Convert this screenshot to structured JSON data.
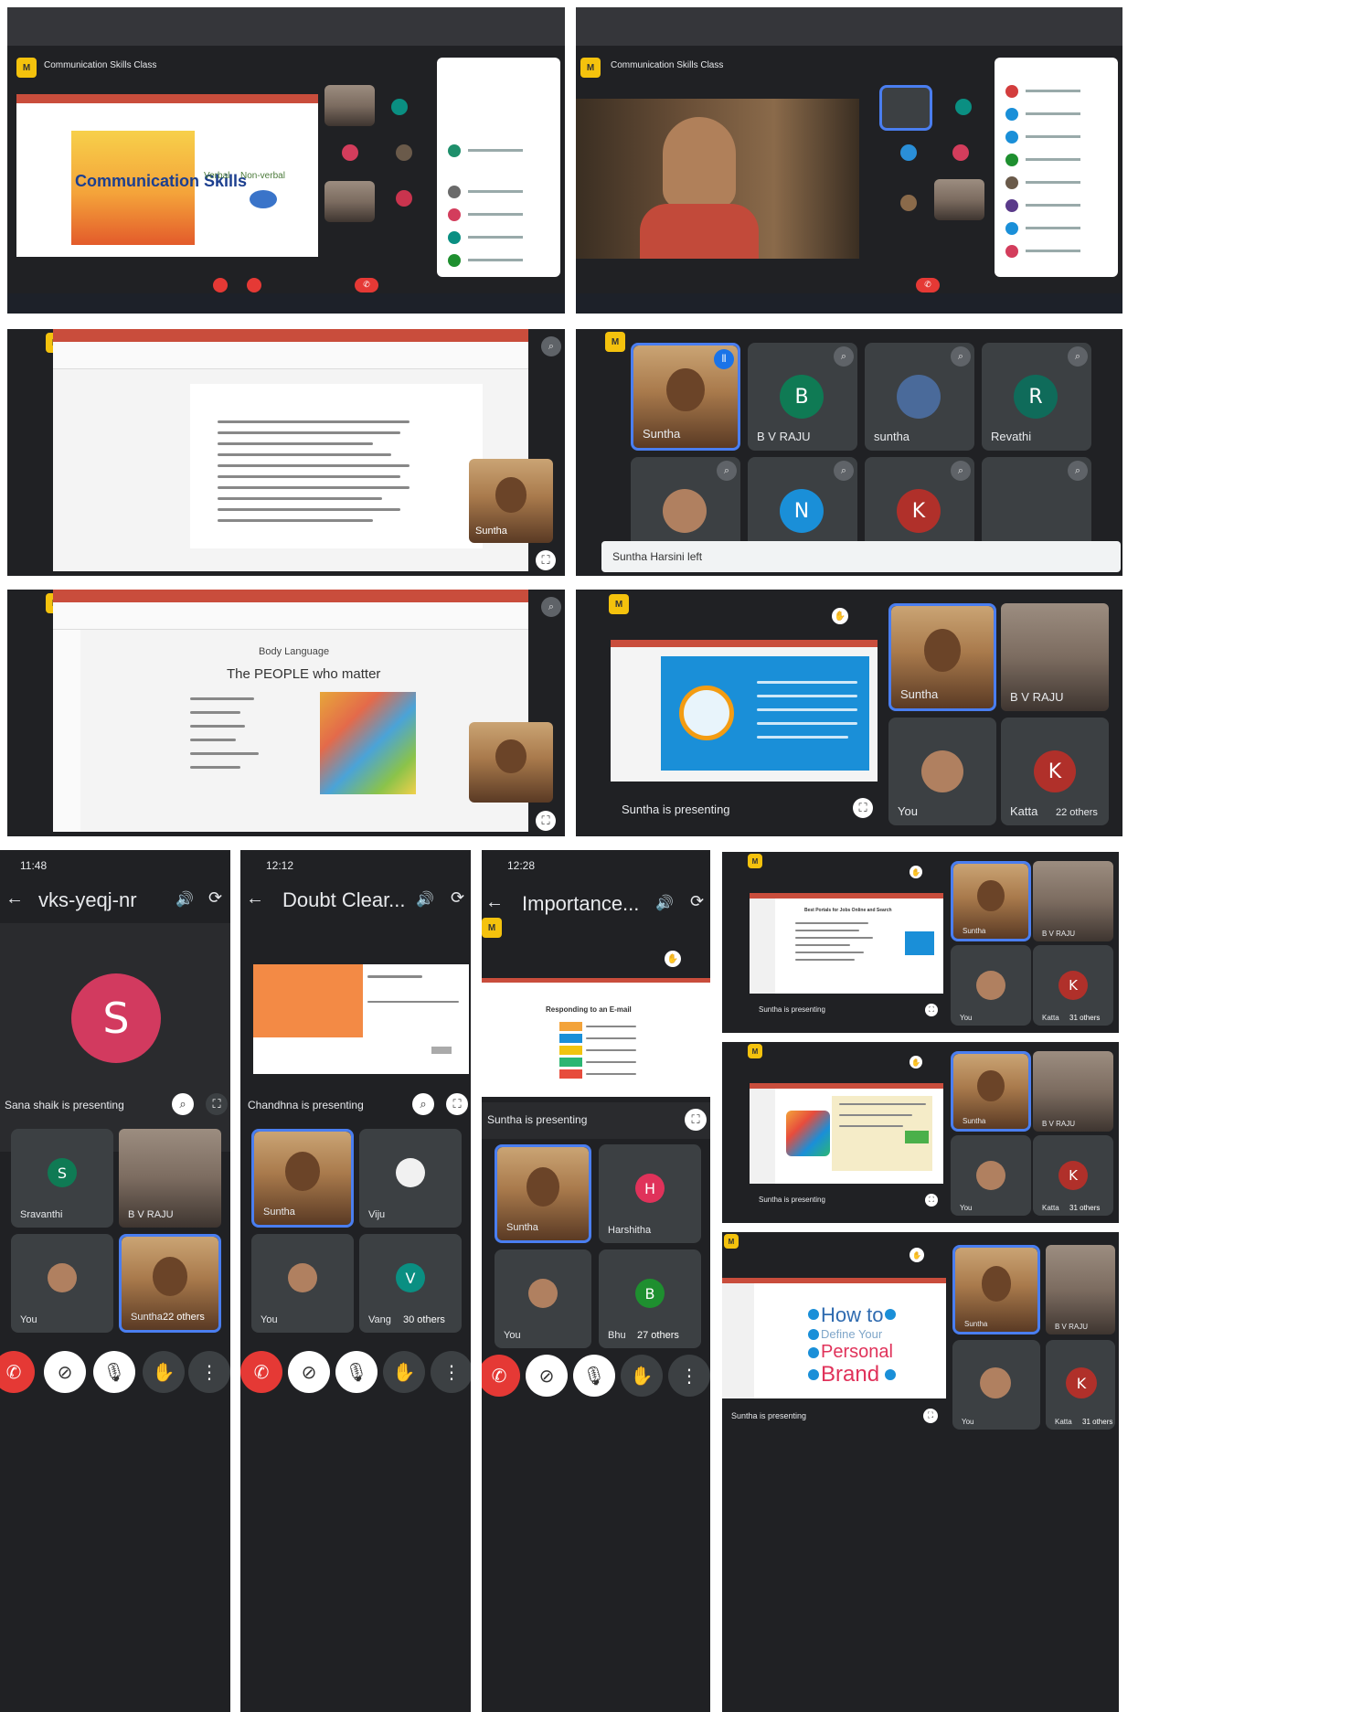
{
  "panel1": {
    "title": "Communication Skills Class",
    "slide_title": "Communication Skills",
    "verbal": "Verbal",
    "nonverbal": "Non-verbal"
  },
  "panel2": {
    "title": "Communication Skills Class"
  },
  "panel3": {
    "speaker": "Suntha"
  },
  "panel4": {
    "tiles": [
      {
        "name": "Suntha",
        "letter": ""
      },
      {
        "name": "B V RAJU",
        "letter": "B",
        "color": "#0f7a54"
      },
      {
        "name": "suntha",
        "letter": ""
      },
      {
        "name": "Revathi",
        "letter": "R",
        "color": "#0f6b5a"
      },
      {
        "name": "",
        "letter": ""
      },
      {
        "name": "",
        "letter": "N",
        "color": "#1a8fd8"
      },
      {
        "name": "",
        "letter": "K",
        "color": "#b0302a"
      },
      {
        "name": "",
        "letter": ""
      }
    ],
    "toast": "Suntha Harsini left"
  },
  "panel5": {
    "slide_title": "Body Language",
    "slide_subtitle": "The PEOPLE who matter"
  },
  "panel6": {
    "presenting": "Suntha is presenting",
    "tiles": [
      "Suntha",
      "B V RAJU",
      "You",
      "Katta",
      "22 others"
    ],
    "k": "K"
  },
  "phone1": {
    "time": "11:48",
    "title": "vks-yeqj-nr",
    "big_letter": "S",
    "presenting": "Sana shaik is presenting",
    "tiles": [
      {
        "name": "Sravanthi",
        "letter": "S"
      },
      {
        "name": "B V RAJU"
      },
      {
        "name": "You"
      },
      {
        "name": "Suntha",
        "extra": "22 others"
      }
    ]
  },
  "phone2": {
    "time": "12:12",
    "title": "Doubt Clear...",
    "presenting": "Chandhna is presenting",
    "tiles": [
      {
        "name": "Suntha"
      },
      {
        "name": "Viju"
      },
      {
        "name": "You"
      },
      {
        "name": "Vang",
        "letter": "V",
        "extra": "30 others"
      }
    ]
  },
  "phone3": {
    "time": "12:28",
    "title": "Importance...",
    "presenting": "Suntha is presenting",
    "slide_title": "Responding to an E-mail",
    "tiles": [
      {
        "name": "Suntha"
      },
      {
        "name": "Harshitha",
        "letter": "H"
      },
      {
        "name": "You"
      },
      {
        "name": "Bhu",
        "letter": "B",
        "extra": "27 others"
      }
    ]
  },
  "panel10": {
    "presenting": "Suntha is presenting",
    "slide_title": "Best Portals for Jobs Online and Search",
    "tiles": [
      "Suntha",
      "B V RAJU",
      "You",
      "Katta",
      "31 others"
    ],
    "k": "K"
  },
  "panel11": {
    "presenting": "Suntha is presenting",
    "tiles": [
      "Suntha",
      "B V RAJU",
      "You",
      "Katta",
      "31 others"
    ],
    "k": "K"
  },
  "panel12": {
    "presenting": "Suntha is presenting",
    "l1": "How to",
    "l2": "Define Your",
    "l3": "Personal",
    "l4": "Brand",
    "tiles": [
      "Suntha",
      "B V RAJU",
      "You",
      "Katta",
      "31 others"
    ],
    "k": "K"
  },
  "icons": {
    "logo": "M"
  }
}
